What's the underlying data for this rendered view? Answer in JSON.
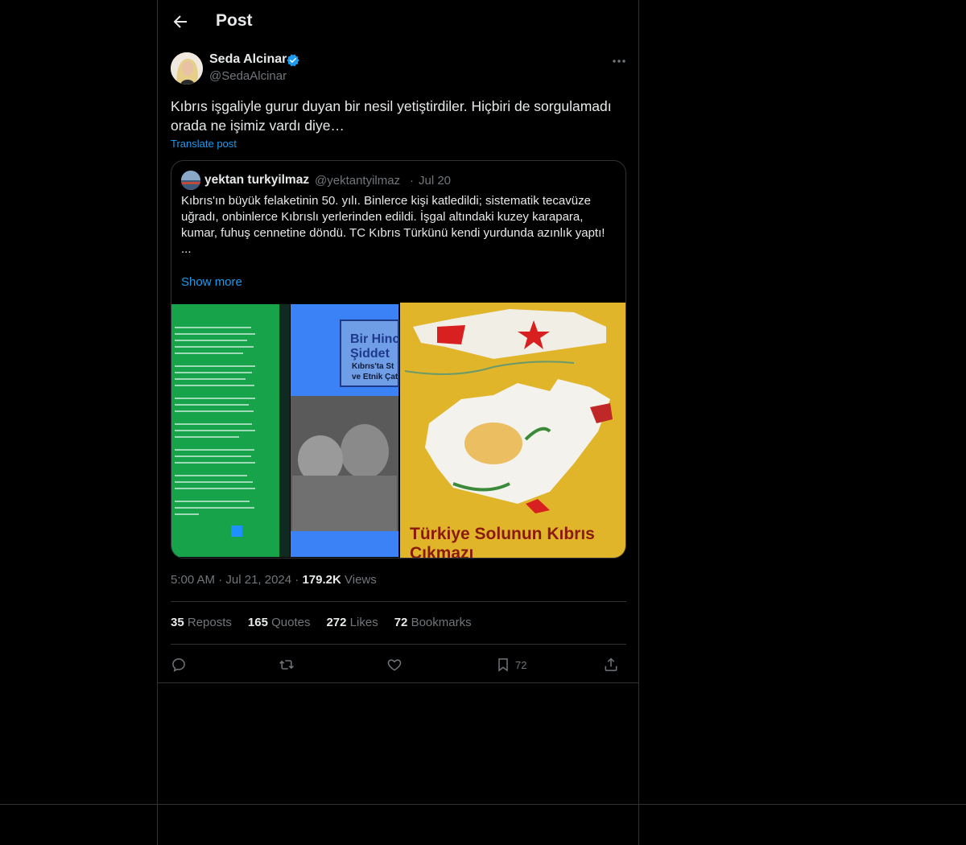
{
  "header": {
    "title": "Post"
  },
  "author": {
    "name": "Seda Alcinar",
    "handle": "@SedaAlcinar"
  },
  "post": {
    "text": "Kıbrıs işgaliyle gurur duyan bir nesil yetiştirdiler. Hiçbiri de sorgulamadı orada ne işimiz vardı diye…",
    "translate_label": "Translate post"
  },
  "quote": {
    "name": "yektan turkyilmaz",
    "handle": "@yektantyilmaz",
    "separator": "·",
    "date": "Jul 20",
    "text": "Kıbrıs'ın büyük felaketinin 50. yılı. Binlerce kişi katledildi; sistematik tecavüze uğradı, onbinlerce Kıbrıslı yerlerinden edildi. İşgal altındaki kuzey karapara, kumar, fuhuş cennetine döndü. TC Kıbrıs Türkünü kendi yurdunda azınlık yaptı!\n...",
    "show_more": "Show more",
    "book_title_1": "Bir Hinc",
    "book_title_2": "Şiddet",
    "book_subtitle_1": "Kıbrıs'ta St",
    "book_subtitle_2": "ve Etnik Çat",
    "spine_text": "Bir Kin ve Şiddet Tarihi · Kıbrıs'ta Statü Kavgası ve Etnik Çatışma",
    "map_caption_1": "Türkiye Solunun Kıbrıs",
    "map_caption_2": "Çıkmazı"
  },
  "meta": {
    "time": "5:00 AM",
    "dot1": "·",
    "date": "Jul 21, 2024",
    "dot2": "·",
    "views_count": "179.2K",
    "views_label": "Views"
  },
  "stats": {
    "reposts_count": "35",
    "reposts_label": "Reposts",
    "quotes_count": "165",
    "quotes_label": "Quotes",
    "likes_count": "272",
    "likes_label": "Likes",
    "bookmarks_count": "72",
    "bookmarks_label": "Bookmarks"
  },
  "actions": {
    "bookmark_count": "72"
  },
  "icons": [
    "back-arrow-icon",
    "verified-badge-icon",
    "more-icon",
    "reply-icon",
    "repost-icon",
    "like-icon",
    "bookmark-icon",
    "share-icon"
  ],
  "colors": {
    "accent": "#1d9bf0",
    "muted": "#71767b",
    "border": "#2f3336",
    "background": "#000000"
  }
}
